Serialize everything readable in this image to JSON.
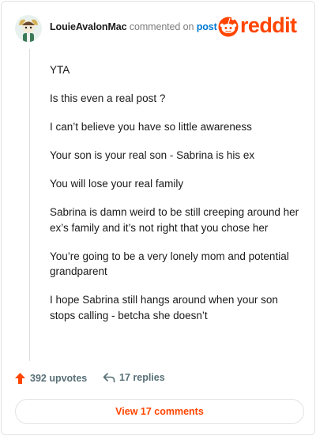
{
  "header": {
    "username": "LouieAvalonMac",
    "verb": "commented on",
    "post_link": "post",
    "brand": "reddit"
  },
  "comment": {
    "paragraphs": [
      "YTA",
      "Is this even a real post ?",
      "I can’t believe you have so little awareness",
      "Your son is your real son - Sabrina is his ex",
      "You will lose your real family",
      "Sabrina is damn weird to be still creeping around her ex’s family and it’s not right that you chose her",
      "You’re going to be a very lonely mom and potential grandparent",
      "I hope Sabrina still hangs around when your son stops calling - betcha she doesn’t"
    ]
  },
  "actions": {
    "upvotes": "392 upvotes",
    "replies": "17 replies",
    "upvote_icon": "upvote-arrow-icon",
    "reply_icon": "reply-arrow-icon"
  },
  "footer": {
    "view_comments": "View 17 comments"
  },
  "colors": {
    "brand": "#ff4500",
    "link": "#0079d3",
    "muted": "#576f76"
  }
}
